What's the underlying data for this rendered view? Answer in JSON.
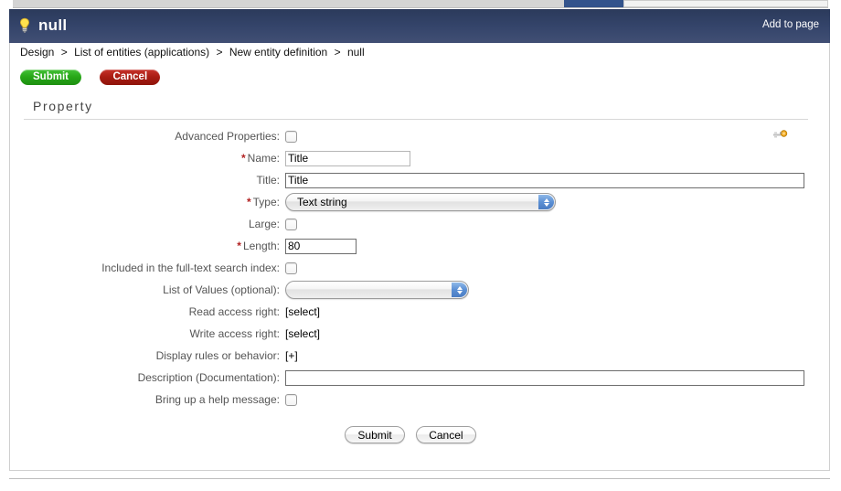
{
  "window": {
    "title": "null",
    "bulb_icon": "lightbulb-icon",
    "add_to_page_label": "Add to page"
  },
  "breadcrumb": {
    "separator": ">",
    "items": [
      {
        "label": "Design"
      },
      {
        "label": "List of entities (applications)"
      },
      {
        "label": "New entity definition"
      },
      {
        "label": "null"
      }
    ]
  },
  "toolbar": {
    "submit_label": "Submit",
    "cancel_label": "Cancel"
  },
  "section": {
    "title": "Property",
    "tool_icon": "wrench-icon"
  },
  "form": {
    "advanced_properties": {
      "label": "Advanced Properties:",
      "checked": false
    },
    "name": {
      "label": "Name:",
      "required": true,
      "required_marker": "*",
      "value": "Title"
    },
    "title": {
      "label": "Title:",
      "required": false,
      "value": "Title"
    },
    "type": {
      "label": "Type:",
      "required": true,
      "required_marker": "*",
      "selected": "Text string"
    },
    "large": {
      "label": "Large:",
      "checked": false
    },
    "length": {
      "label": "Length:",
      "required": true,
      "required_marker": "*",
      "value": "80"
    },
    "fulltext_index": {
      "label": "Included in the full-text search index:",
      "checked": false
    },
    "list_of_values": {
      "label": "List of Values (optional):",
      "selected": ""
    },
    "read_access_right": {
      "label": "Read access right:",
      "value": "[select]"
    },
    "write_access_right": {
      "label": "Write access right:",
      "value": "[select]"
    },
    "display_rules": {
      "label": "Display rules or behavior:",
      "value": "[+]"
    },
    "description": {
      "label": "Description (Documentation):",
      "value": ""
    },
    "help_message": {
      "label": "Bring up a help message:",
      "checked": false
    }
  },
  "footer": {
    "submit_label": "Submit",
    "cancel_label": "Cancel"
  },
  "colors": {
    "header_top": "#2b3a5b",
    "header_bottom": "#414f74",
    "submit_green": "#28a818",
    "cancel_red": "#ab1d13",
    "required_red": "#b22222",
    "select_arrow_blue": "#5b8fd4"
  }
}
